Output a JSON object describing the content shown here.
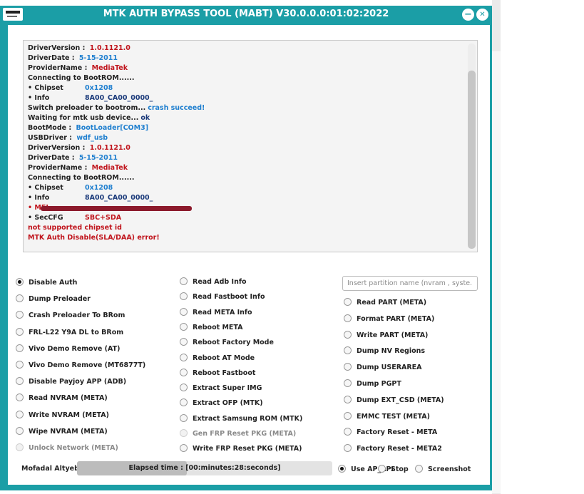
{
  "window": {
    "title": "MTK AUTH BYPASS TOOL (MABT) V30.0.0.0:01:02:2022",
    "minimize_icon": "minus-icon",
    "close_icon": "close-icon",
    "minimize_glyph": "−",
    "close_glyph": "✕"
  },
  "colors": {
    "title_bar": "#1b9ea6",
    "log_red": "#c0141c",
    "log_blue": "#1f7fcf",
    "log_navy": "#1b3a7a"
  },
  "log": {
    "lines": [
      {
        "label": "DriverVersion : ",
        "value": "1.0.1121.0",
        "color": "red"
      },
      {
        "label": "DriverDate : ",
        "value": "5-15-2011",
        "color": "blue"
      },
      {
        "label": "ProviderName : ",
        "value": "MediaTek",
        "color": "red"
      },
      {
        "label": "Connecting to BootROM......",
        "value": "",
        "color": ""
      },
      {
        "label": "• Chipset",
        "value": "0x1208",
        "color": "blue",
        "tab": true
      },
      {
        "label": "• Info",
        "value": "8A00_CA00_0000_",
        "color": "navy",
        "tab": true
      },
      {
        "label": "Switch preloader to bootrom...",
        "value": "crash succeed!",
        "color": "blue"
      },
      {
        "label": "Waiting for mtk usb device...",
        "value": "ok",
        "color": "navy"
      },
      {
        "label": "BootMode : ",
        "value": "BootLoader[COM3]",
        "color": "blue"
      },
      {
        "label": "USBDriver : ",
        "value": "wdf_usb",
        "color": "blue"
      },
      {
        "label": "DriverVersion : ",
        "value": "1.0.1121.0",
        "color": "red"
      },
      {
        "label": "DriverDate : ",
        "value": "5-15-2011",
        "color": "blue"
      },
      {
        "label": "ProviderName : ",
        "value": "MediaTek",
        "color": "red"
      },
      {
        "label": "Connecting to BootROM......",
        "value": "",
        "color": ""
      },
      {
        "label": "• Chipset",
        "value": "0x1208",
        "color": "blue",
        "tab": true
      },
      {
        "label": "• Info",
        "value": "8A00_CA00_0000_",
        "color": "navy",
        "tab": true
      },
      {
        "label": "• MEI",
        "value": "",
        "color": "red",
        "redacted": true,
        "label_color": "red"
      },
      {
        "label": "• SecCFG",
        "value": "SBC+SDA",
        "color": "red",
        "tab": true
      },
      {
        "label": "not supported chipset id",
        "value": "",
        "color": "",
        "label_color": "red"
      },
      {
        "label": "MTK Auth Disable(SLA/DAA) error!",
        "value": "",
        "color": "",
        "label_color": "red"
      }
    ]
  },
  "options": {
    "col1": [
      {
        "label": "Disable Auth",
        "checked": true
      },
      {
        "label": "Dump Preloader"
      },
      {
        "label": "Crash Preloader To BRom"
      },
      {
        "label": "FRL-L22 Y9A DL to BRom"
      },
      {
        "label": "Vivo Demo Remove (AT)"
      },
      {
        "label": "Vivo Demo Remove (MT6877T)"
      },
      {
        "label": "Disable Payjoy APP (ADB)"
      },
      {
        "label": "Read NVRAM (META)"
      },
      {
        "label": "Write NVRAM (META)"
      },
      {
        "label": "Wipe NVRAM (META)"
      },
      {
        "label": "Unlock Network (META)",
        "disabled": true
      }
    ],
    "col2": [
      {
        "label": "Read Adb Info"
      },
      {
        "label": "Read Fastboot Info"
      },
      {
        "label": "Read META Info"
      },
      {
        "label": "Reboot META"
      },
      {
        "label": "Reboot Factory Mode"
      },
      {
        "label": "Reboot AT Mode"
      },
      {
        "label": "Reboot Fastboot"
      },
      {
        "label": "Extract Super IMG"
      },
      {
        "label": "Extract OFP (MTK)"
      },
      {
        "label": "Extract Samsung ROM (MTK)"
      },
      {
        "label": "Gen FRP Reset PKG (META)",
        "disabled": true
      },
      {
        "label": "Write FRP Reset PKG (META)"
      }
    ],
    "col3": [
      {
        "label": "Read PART (META)"
      },
      {
        "label": "Format PART (META)"
      },
      {
        "label": "Write PART (META)"
      },
      {
        "label": "Dump NV Regions"
      },
      {
        "label": "Dump USERAREA"
      },
      {
        "label": "Dump PGPT"
      },
      {
        "label": "Dump  EXT_CSD (META)"
      },
      {
        "label": "EMMC TEST (META)"
      },
      {
        "label": "Factory Reset - META"
      },
      {
        "label": "Factory Reset - META2"
      }
    ]
  },
  "partition_input": {
    "placeholder": "Insert partition name (nvram , syste...",
    "value": ""
  },
  "footer": {
    "author": "Mofadal Altyeb",
    "elapsed_label": "Elapsed time : ",
    "elapsed_value": "[00:minutes:28:seconds]",
    "progress_fraction": 0.43,
    "modes": [
      {
        "label": "Use AP_API",
        "checked": true
      },
      {
        "label": "Stop"
      },
      {
        "label": "Screenshot"
      }
    ]
  }
}
